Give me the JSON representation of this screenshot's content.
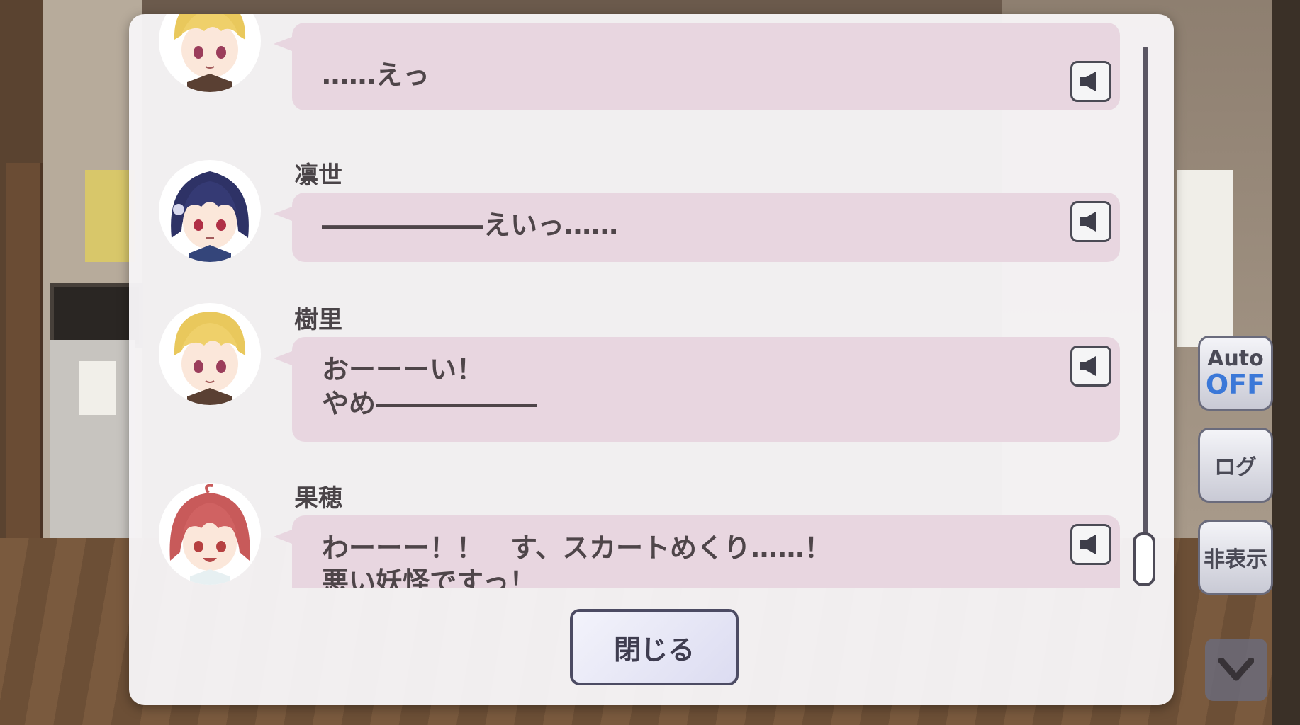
{
  "log": {
    "entries": [
      {
        "speaker": "",
        "avatar": "blonde-character",
        "lines": [
          "……えっ"
        ]
      },
      {
        "speaker": "凛世",
        "avatar": "navy-hair-character",
        "lines": [
          "――――――えいっ……"
        ]
      },
      {
        "speaker": "樹里",
        "avatar": "blonde-character",
        "lines": [
          "おーーーい！",
          "やめ――――――"
        ]
      },
      {
        "speaker": "果穂",
        "avatar": "red-hair-character",
        "lines": [
          "わーーー！！　す、スカートめくり……！",
          "悪い妖怪ですっ！"
        ]
      }
    ]
  },
  "close_label": "閉じる",
  "side": {
    "auto_label": "Auto",
    "auto_value": "OFF",
    "log_label": "ログ",
    "hide_label": "非表示"
  },
  "colors": {
    "bubble": "#e8d6e0",
    "auto_off": "#3b78d8"
  },
  "icons": {
    "voice": "speaker-icon",
    "down": "chevron-down-icon"
  }
}
